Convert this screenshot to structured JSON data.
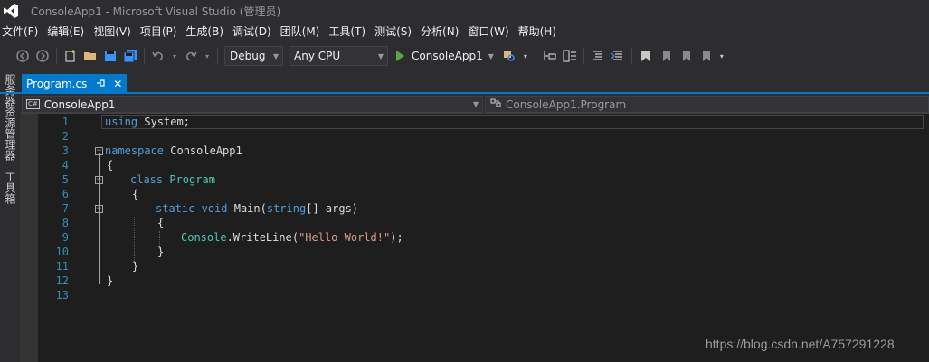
{
  "window": {
    "title": "ConsoleApp1 - Microsoft Visual Studio (管理员)"
  },
  "menu": [
    "文件(F)",
    "编辑(E)",
    "视图(V)",
    "项目(P)",
    "生成(B)",
    "调试(D)",
    "团队(M)",
    "工具(T)",
    "测试(S)",
    "分析(N)",
    "窗口(W)",
    "帮助(H)"
  ],
  "toolbar": {
    "config": "Debug",
    "platform": "Any CPU",
    "start_label": "ConsoleApp1"
  },
  "side_panels": [
    "服务器资源管理器",
    "工具箱"
  ],
  "tab": {
    "label": "Program.cs",
    "pin": "ㅁ",
    "close": "✕"
  },
  "navbar": {
    "project": "ConsoleApp1",
    "class": "ConsoleApp1.Program"
  },
  "editor": {
    "lines": [
      "1",
      "2",
      "3",
      "4",
      "5",
      "6",
      "7",
      "8",
      "9",
      "10",
      "11",
      "12",
      "13"
    ],
    "code": {
      "l1_kw": "using",
      "l1_rest": " System;",
      "l3_kw": "namespace",
      "l3_rest": " ConsoleApp1",
      "l4": "{",
      "l5_kw": "class",
      "l5_ty": "Program",
      "l6": "{",
      "l7_kw1": "static",
      "l7_kw2": "void",
      "l7_fn": "Main(",
      "l7_kw3": "string",
      "l7_rest": "[] args)",
      "l8": "{",
      "l9_ty": "Console",
      "l9_mid": ".WriteLine(",
      "l9_str": "\"Hello World!\"",
      "l9_end": ");",
      "l10": "}",
      "l11": "}",
      "l12": "}"
    }
  },
  "watermark": "https://blog.csdn.net/A757291228",
  "colors": {
    "accent": "#007acc",
    "keyword": "#569cd6",
    "type": "#4ec9b0",
    "string": "#d69d85",
    "line_number": "#2b91af"
  }
}
